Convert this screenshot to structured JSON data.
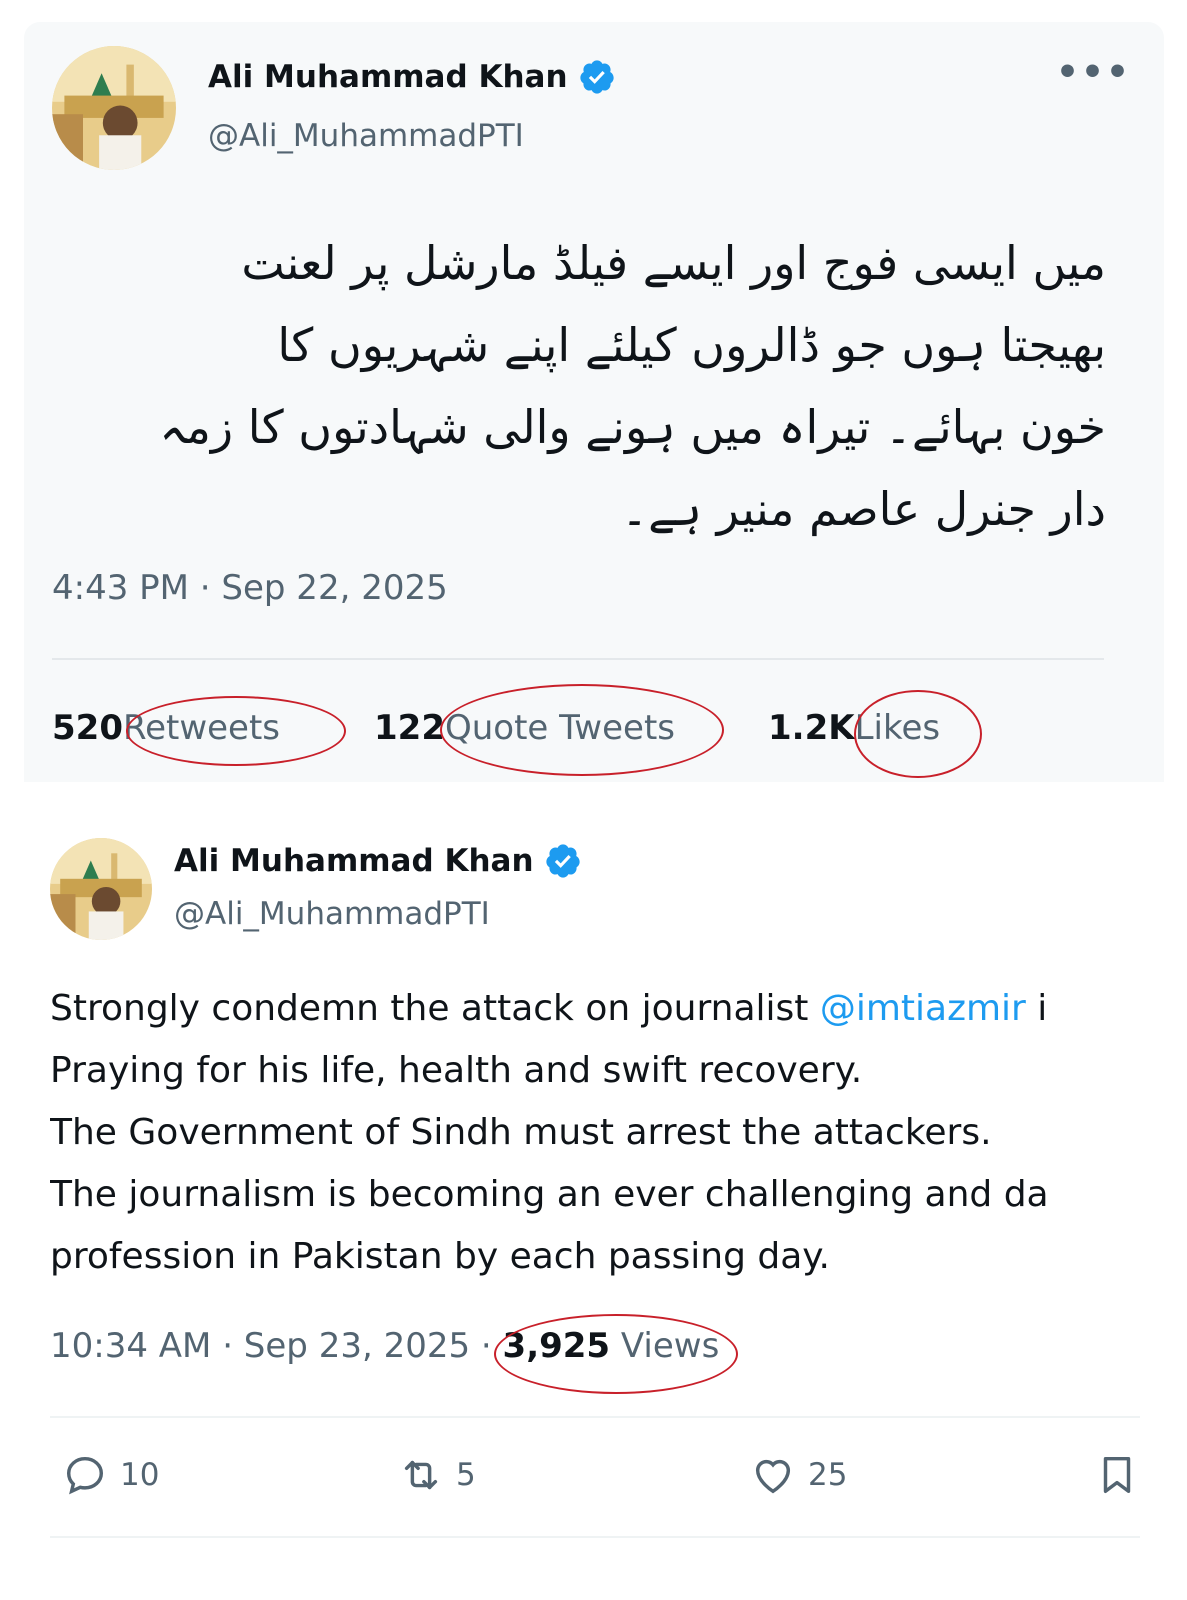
{
  "tweet1": {
    "author_name": "Ali Muhammad Khan",
    "handle": "@Ali_MuhammadPTI",
    "more_label": "•••",
    "text_lines": [
      "میں ایسی فوج اور ایسے فیلڈ مارشل پر لعنت",
      "بھیجتا ہوں جو ڈالروں کیلئے اپنے شہریوں کا",
      "خون بہائے۔ تیراہ میں ہونے والی شہادتوں کا زمہ",
      "دار جنرل عاصم منیر ہے۔"
    ],
    "timestamp": "4:43 PM · Sep 22, 2025",
    "stats": {
      "retweets_count": "520",
      "retweets_label": "Retweets",
      "quotes_count": "122",
      "quotes_label": "Quote Tweets",
      "likes_count": "1.2K",
      "likes_label": "Likes"
    }
  },
  "tweet2": {
    "author_name": "Ali Muhammad Khan",
    "handle": "@Ali_MuhammadPTI",
    "line1_prefix": "Strongly condemn the attack on journalist ",
    "mention": "@imtiazmir",
    "line1_suffix": " i",
    "line2": "Praying for his life, health and swift recovery.",
    "line3": "The Government of Sindh must arrest the attackers.",
    "line4": "The journalism is becoming  an ever  challenging and da",
    "line5": "profession in Pakistan by each passing day.",
    "timestamp": "10:34 AM · Sep 23, 2025 · ",
    "views_count": "3,925",
    "views_label": " Views",
    "actions": {
      "replies": "10",
      "retweets": "5",
      "likes": "25"
    }
  },
  "icons": [
    "verified-badge-icon",
    "more-icon",
    "reply-icon",
    "retweet-icon",
    "like-icon",
    "bookmark-icon"
  ],
  "colors": {
    "verified_blue": "#1d9bf0",
    "annotation_red": "#c8202a",
    "secondary_text": "#536471"
  }
}
